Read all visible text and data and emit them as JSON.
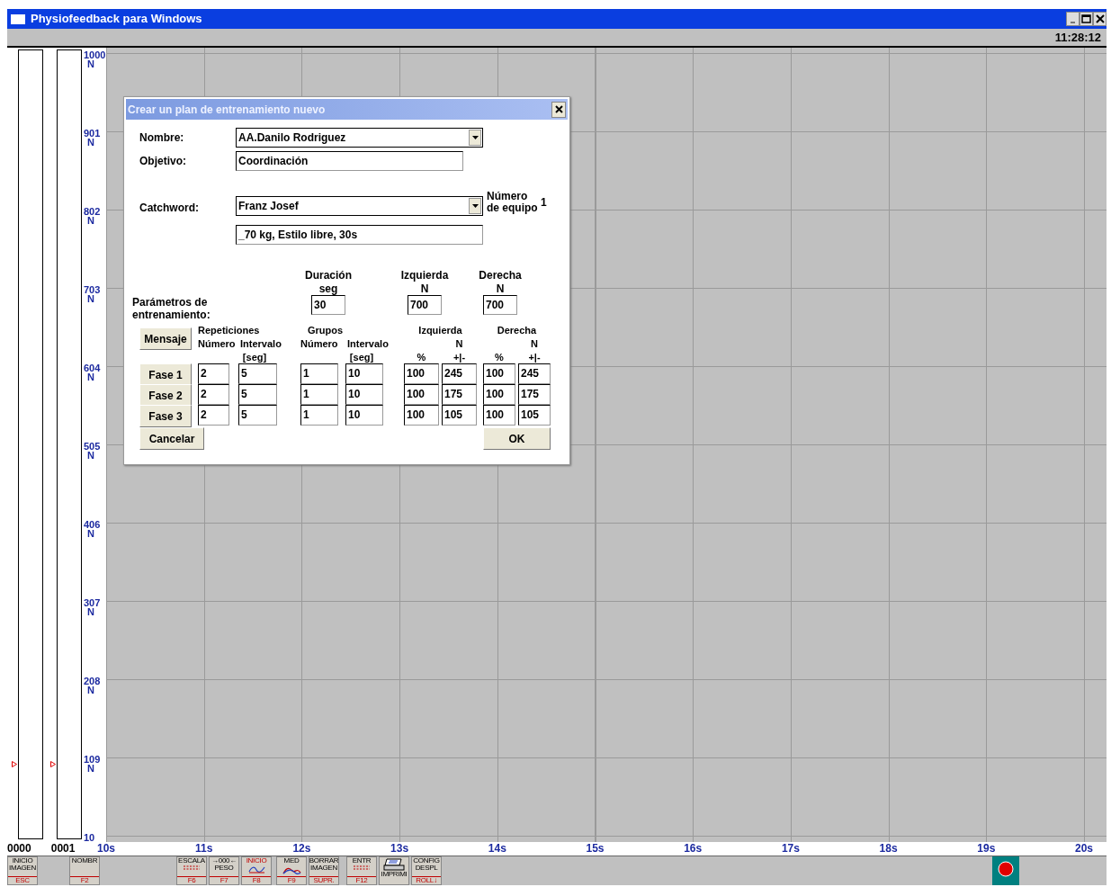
{
  "window": {
    "title": "Physiofeedback para Windows"
  },
  "status_bar": {
    "time": "11:28:12"
  },
  "meters": [
    {
      "label": "0000",
      "level": 0.09
    },
    {
      "label": "0001",
      "level": 0.09
    }
  ],
  "plot": {
    "y_labels": [
      {
        "value": "1000",
        "unit": "N"
      },
      {
        "value": "901",
        "unit": "N"
      },
      {
        "value": "802",
        "unit": "N"
      },
      {
        "value": "703",
        "unit": "N"
      },
      {
        "value": "604",
        "unit": "N"
      },
      {
        "value": "505",
        "unit": "N"
      },
      {
        "value": "406",
        "unit": "N"
      },
      {
        "value": "307",
        "unit": "N"
      },
      {
        "value": "208",
        "unit": "N"
      },
      {
        "value": "109",
        "unit": "N"
      },
      {
        "value": "10"
      }
    ],
    "x_labels": [
      "10s",
      "11s",
      "12s",
      "13s",
      "14s",
      "15s",
      "16s",
      "17s",
      "18s",
      "19s",
      "20s"
    ]
  },
  "dialog": {
    "title": "Crear un plan de entrenamiento nuevo",
    "name": {
      "label": "Nombre:",
      "value": "AA.Danilo Rodriguez"
    },
    "objective": {
      "label": "Objetivo:",
      "value": "Coordinación"
    },
    "catchword": {
      "label": "Catchword:",
      "value": "Franz Josef"
    },
    "device": {
      "label": "Número de equipo",
      "value": "1"
    },
    "description": {
      "value": "_70 kg, Estilo libre, 30s"
    },
    "parameters": {
      "label": "Parámetros de entrenamiento:",
      "fields": [
        {
          "label": "Duración",
          "unit": "seg",
          "value": "30"
        },
        {
          "label": "Izquierda",
          "unit": "N",
          "value": "700"
        },
        {
          "label": "Derecha",
          "unit": "N",
          "value": "700"
        }
      ]
    },
    "phase_table": {
      "message_button": "Mensaje",
      "groups": [
        {
          "kind": "timed",
          "title": "Repeticiones",
          "columns": [
            {
              "label": "Número"
            },
            {
              "label": "Intervalo",
              "unit": "[seg]"
            }
          ]
        },
        {
          "kind": "timed",
          "title": "Grupos",
          "columns": [
            {
              "label": "Número"
            },
            {
              "label": "Intervalo",
              "unit": "[seg]"
            }
          ]
        },
        {
          "kind": "force",
          "title": "Izquierda",
          "unit": "N",
          "columns": [
            {
              "label": "%"
            },
            {
              "label": "+|-"
            }
          ]
        },
        {
          "kind": "force",
          "title": "Derecha",
          "unit": "N",
          "columns": [
            {
              "label": "%"
            },
            {
              "label": "+|-"
            }
          ]
        }
      ],
      "rows": [
        {
          "label": "Fase 1",
          "values": [
            "2",
            "5",
            "1",
            "10",
            "100",
            "245",
            "100",
            "245"
          ]
        },
        {
          "label": "Fase 2",
          "values": [
            "2",
            "5",
            "1",
            "10",
            "100",
            "175",
            "100",
            "175"
          ]
        },
        {
          "label": "Fase 3",
          "values": [
            "2",
            "5",
            "1",
            "10",
            "100",
            "105",
            "100",
            "105"
          ]
        }
      ]
    },
    "cancel": "Cancelar",
    "ok": "OK"
  },
  "toolbar": {
    "groups": [
      [
        {
          "lines": [
            "INICIO",
            "IMAGEN"
          ],
          "key": "ESC"
        }
      ],
      [
        {
          "lines": [
            "NOMBR"
          ],
          "key": "F2"
        }
      ],
      [
        {
          "lines": [
            "ESCALA"
          ],
          "key": "F6",
          "kind": "dots"
        },
        {
          "lines": [
            "→000←",
            "PESO"
          ],
          "key": "F7"
        },
        {
          "lines": [
            "INICIO"
          ],
          "key": "F8",
          "kind": "curve"
        }
      ],
      [
        {
          "lines": [
            "MED"
          ],
          "key": "F9",
          "kind": "chart"
        },
        {
          "lines": [
            "BORRAR",
            "IMAGEN"
          ],
          "key": "SUPR."
        }
      ],
      [
        {
          "lines": [
            "ENTR"
          ],
          "key": "F12",
          "kind": "dots"
        }
      ],
      [
        {
          "lines": [
            "IMPRIMI"
          ],
          "kind": "printer"
        },
        {
          "lines": [
            "CONFIG",
            "DESPL"
          ],
          "key": "ROLL↓"
        }
      ]
    ]
  }
}
